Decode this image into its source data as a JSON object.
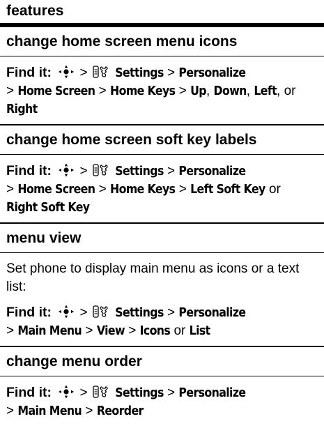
{
  "header": {
    "title": "features"
  },
  "sections": [
    {
      "title": "change home screen menu icons",
      "find_label": "Find it:",
      "gt": ">",
      "path": {
        "settings": "Settings",
        "personalize": "Personalize",
        "home_screen": "Home Screen",
        "home_keys": "Home Keys",
        "up": "Up",
        "down": "Down",
        "left": "Left",
        "comma": ",",
        "or": "or",
        "right": "Right"
      }
    },
    {
      "title": "change home screen soft key labels",
      "find_label": "Find it:",
      "gt": ">",
      "path": {
        "settings": "Settings",
        "personalize": "Personalize",
        "home_screen": "Home Screen",
        "home_keys": "Home Keys",
        "left_soft_key": "Left Soft Key",
        "or": "or",
        "right_soft_key": "Right Soft Key"
      }
    },
    {
      "title": "menu view",
      "description": "Set phone to display main menu as icons or a text list:",
      "find_label": "Find it:",
      "gt": ">",
      "path": {
        "settings": "Settings",
        "personalize": "Personalize",
        "main_menu": "Main Menu",
        "view": "View",
        "icons": "Icons",
        "or": "or",
        "list": "List"
      }
    },
    {
      "title": "change menu order",
      "find_label": "Find it:",
      "gt": ">",
      "path": {
        "settings": "Settings",
        "personalize": "Personalize",
        "main_menu": "Main Menu",
        "reorder": "Reorder"
      }
    }
  ],
  "icons": {
    "nav_key": "nav-key-icon",
    "settings": "settings-icon"
  }
}
